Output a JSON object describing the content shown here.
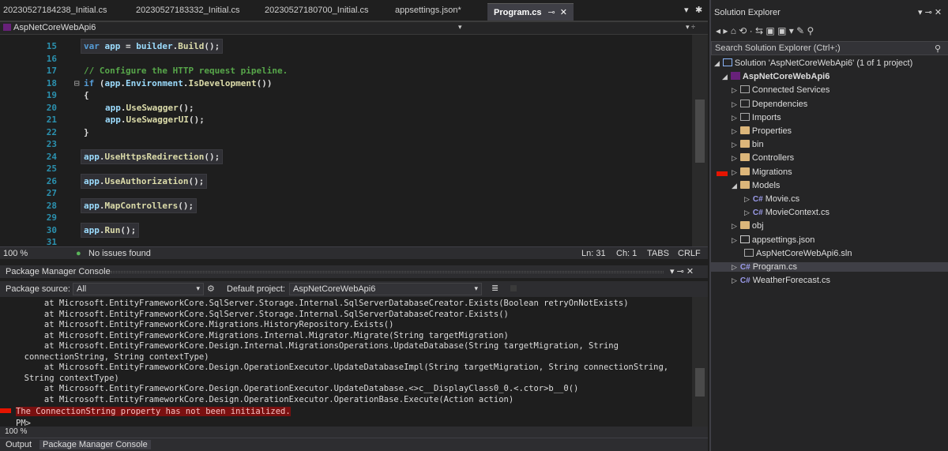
{
  "tabs": [
    {
      "label": "20230527184238_Initial.cs"
    },
    {
      "label": "20230527183332_Initial.cs"
    },
    {
      "label": "20230527180700_Initial.cs"
    },
    {
      "label": "appsettings.json*"
    },
    {
      "label": "Program.cs",
      "active": true
    }
  ],
  "tab_pin": "⊸",
  "tab_close": "✕",
  "nav": {
    "project": "AspNetCoreWebApi6"
  },
  "editor": {
    "lines": [
      {
        "n": "15",
        "text": "var app = builder.Build();"
      },
      {
        "n": "16",
        "text": ""
      },
      {
        "n": "17",
        "text": "// Configure the HTTP request pipeline."
      },
      {
        "n": "18",
        "text": "if (app.Environment.IsDevelopment())"
      },
      {
        "n": "19",
        "text": "{"
      },
      {
        "n": "20",
        "text": "app.UseSwagger();"
      },
      {
        "n": "21",
        "text": "app.UseSwaggerUI();"
      },
      {
        "n": "22",
        "text": "}"
      },
      {
        "n": "23",
        "text": ""
      },
      {
        "n": "24",
        "text": "app.UseHttpsRedirection();"
      },
      {
        "n": "25",
        "text": ""
      },
      {
        "n": "26",
        "text": "app.UseAuthorization();"
      },
      {
        "n": "27",
        "text": ""
      },
      {
        "n": "28",
        "text": "app.MapControllers();"
      },
      {
        "n": "29",
        "text": ""
      },
      {
        "n": "30",
        "text": "app.Run();"
      },
      {
        "n": "31",
        "text": ""
      }
    ]
  },
  "status": {
    "zoom": "100 %",
    "issues": "No issues found",
    "ln": "Ln: 31",
    "ch": "Ch: 1",
    "tabs": "TABS",
    "crlf": "CRLF"
  },
  "pmc": {
    "title": "Package Manager Console",
    "source_label": "Package source:",
    "source_value": "All",
    "default_label": "Default project:",
    "default_value": "AspNetCoreWebApi6",
    "lines": [
      "      at Microsoft.EntityFrameworkCore.SqlServer.Storage.Internal.SqlServerDatabaseCreator.Exists(Boolean retryOnNotExists)",
      "      at Microsoft.EntityFrameworkCore.SqlServer.Storage.Internal.SqlServerDatabaseCreator.Exists()",
      "      at Microsoft.EntityFrameworkCore.Migrations.HistoryRepository.Exists()",
      "      at Microsoft.EntityFrameworkCore.Migrations.Internal.Migrator.Migrate(String targetMigration)",
      "      at Microsoft.EntityFrameworkCore.Design.Internal.MigrationsOperations.UpdateDatabase(String targetMigration, String",
      "  connectionString, String contextType)",
      "      at Microsoft.EntityFrameworkCore.Design.OperationExecutor.UpdateDatabaseImpl(String targetMigration, String connectionString,",
      "  String contextType)",
      "      at Microsoft.EntityFrameworkCore.Design.OperationExecutor.UpdateDatabase.<>c__DisplayClass0_0.<.ctor>b__0()",
      "      at Microsoft.EntityFrameworkCore.Design.OperationExecutor.OperationBase.Execute(Action action)"
    ],
    "error": "The ConnectionString property has not been initialized.",
    "prompt": "PM>",
    "zoom": "100 %"
  },
  "bottom_tabs": [
    "Output",
    "Package Manager Console"
  ],
  "solution_explorer": {
    "title": "Solution Explorer",
    "search_placeholder": "Search Solution Explorer (Ctrl+;)",
    "items": [
      {
        "label": "Solution 'AspNetCoreWebApi6' (1 of 1 project)"
      },
      {
        "label": "AspNetCoreWebApi6"
      },
      {
        "label": "Connected Services"
      },
      {
        "label": "Dependencies"
      },
      {
        "label": "Imports"
      },
      {
        "label": "Properties"
      },
      {
        "label": "bin"
      },
      {
        "label": "Controllers"
      },
      {
        "label": "Migrations"
      },
      {
        "label": "Models"
      },
      {
        "label": "Movie.cs"
      },
      {
        "label": "MovieContext.cs"
      },
      {
        "label": "obj"
      },
      {
        "label": "appsettings.json"
      },
      {
        "label": "AspNetCoreWebApi6.sln"
      },
      {
        "label": "Program.cs"
      },
      {
        "label": "WeatherForecast.cs"
      }
    ]
  },
  "colors": {
    "accent": "#007acc",
    "error": "#e51400",
    "keyword": "#569cd6",
    "comment": "#57a64a"
  }
}
